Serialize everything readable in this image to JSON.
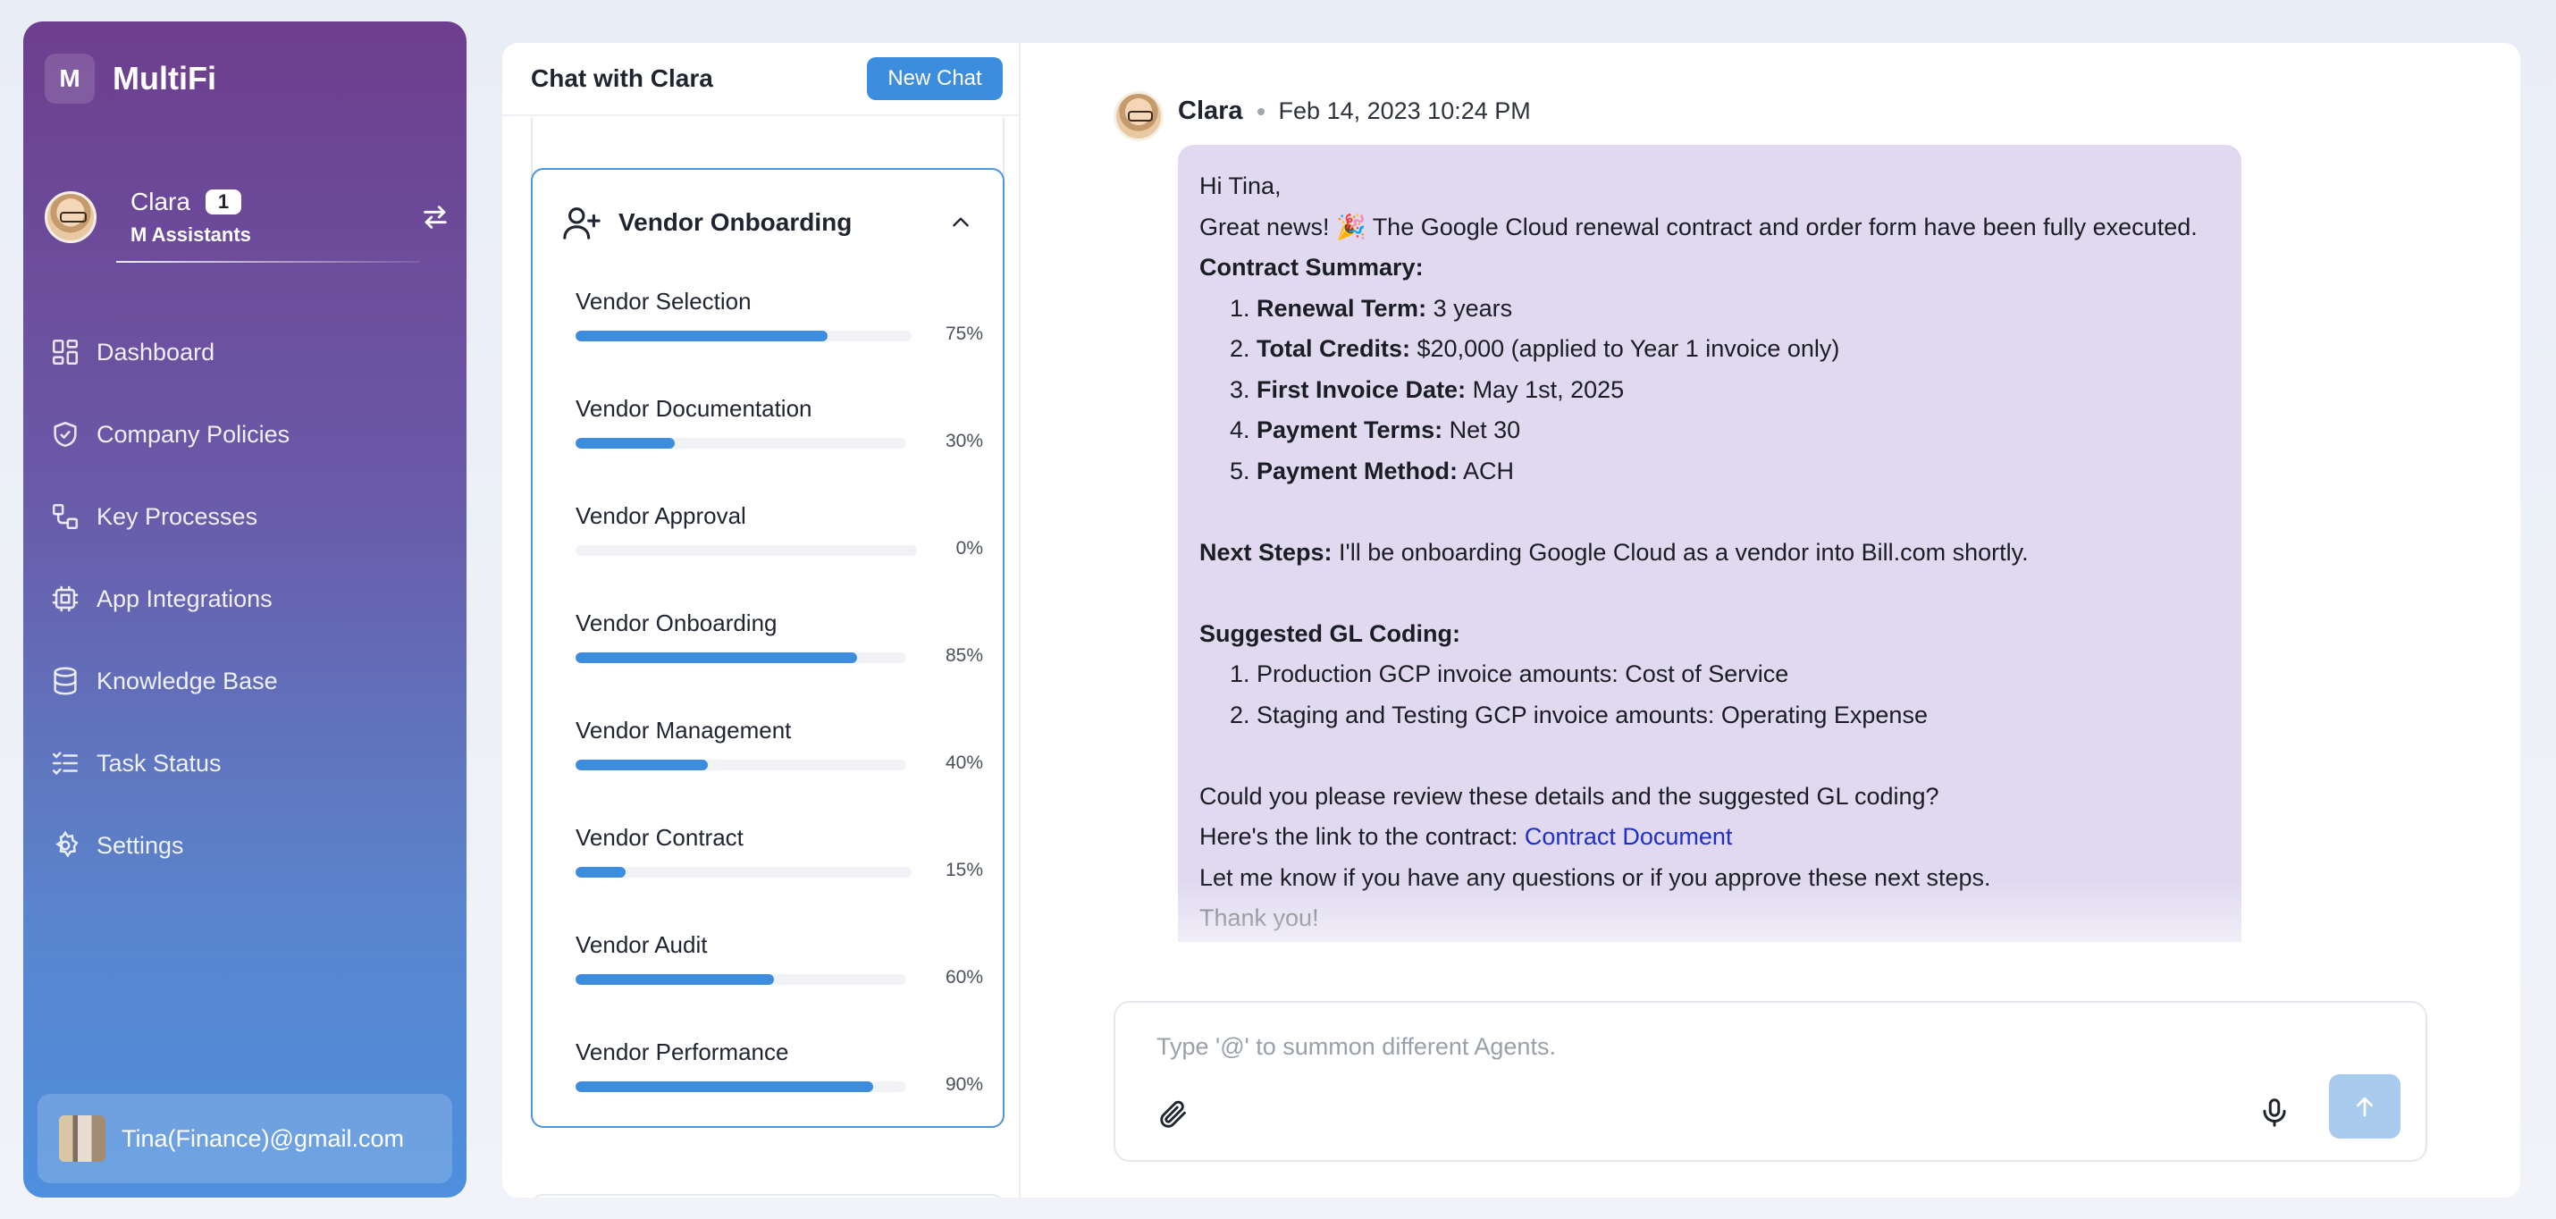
{
  "brand": {
    "logo_letter": "M",
    "name": "MultiFi"
  },
  "profile": {
    "name": "Clara",
    "badge": "1",
    "subtitle": "M Assistants"
  },
  "nav": {
    "items": [
      {
        "label": "Dashboard",
        "icon": "dashboard-icon"
      },
      {
        "label": "Company Policies",
        "icon": "shield-check-icon"
      },
      {
        "label": "Key Processes",
        "icon": "process-icon"
      },
      {
        "label": "App Integrations",
        "icon": "chip-icon"
      },
      {
        "label": "Knowledge Base",
        "icon": "database-icon"
      },
      {
        "label": "Task Status",
        "icon": "checklist-icon"
      },
      {
        "label": "Settings",
        "icon": "gear-icon"
      }
    ]
  },
  "account": {
    "email": "Tina(Finance)@gmail.com"
  },
  "middle": {
    "title": "Chat with Clara",
    "new_chat_label": "New Chat",
    "section": {
      "title": "Vendor Onboarding",
      "items": [
        {
          "label": "Vendor Selection",
          "percent": 75,
          "percent_text": "75%"
        },
        {
          "label": "Vendor Documentation",
          "percent": 30,
          "percent_text": "30%"
        },
        {
          "label": "Vendor Approval",
          "percent": 0,
          "percent_text": "0%"
        },
        {
          "label": "Vendor Onboarding",
          "percent": 85,
          "percent_text": "85%"
        },
        {
          "label": "Vendor Management",
          "percent": 40,
          "percent_text": "40%"
        },
        {
          "label": "Vendor Contract",
          "percent": 15,
          "percent_text": "15%"
        },
        {
          "label": "Vendor Audit",
          "percent": 60,
          "percent_text": "60%"
        },
        {
          "label": "Vendor Performance",
          "percent": 90,
          "percent_text": "90%"
        }
      ]
    }
  },
  "message": {
    "sender": "Clara",
    "timestamp": "Feb 14, 2023 10:24 PM",
    "greeting": "Hi Tina,",
    "intro": "Great news! 🎉 The Google Cloud renewal contract and order form have been fully executed.",
    "summary_heading": "Contract Summary:",
    "summary_items": [
      {
        "label": "Renewal Term:",
        "value": " 3 years"
      },
      {
        "label": "Total Credits:",
        "value": " $20,000 (applied to Year 1 invoice only)"
      },
      {
        "label": "First Invoice Date:",
        "value": " May 1st, 2025"
      },
      {
        "label": "Payment Terms:",
        "value": " Net 30"
      },
      {
        "label": "Payment Method:",
        "value": " ACH"
      }
    ],
    "next_steps_label": "Next Steps:",
    "next_steps_text": " I'll be onboarding Google Cloud as a vendor into Bill.com shortly.",
    "gl_heading": "Suggested GL Coding:",
    "gl_items": [
      "Production GCP invoice amounts: Cost of Service",
      "Staging and Testing GCP invoice amounts: Operating Expense"
    ],
    "review_text": "Could you please review these details and the suggested GL coding?",
    "link_prefix": "Here's the link to the contract: ",
    "link_text": "Contract Document",
    "closing_text": "Let me know if you have any questions or if you approve these next steps.",
    "sign_off": "Thank you!"
  },
  "composer": {
    "placeholder": "Type '@' to summon different Agents.",
    "value": ""
  },
  "colors": {
    "accent": "#3d8ddf",
    "bubble": "#e0d9f0",
    "link": "#1f2fc8"
  }
}
